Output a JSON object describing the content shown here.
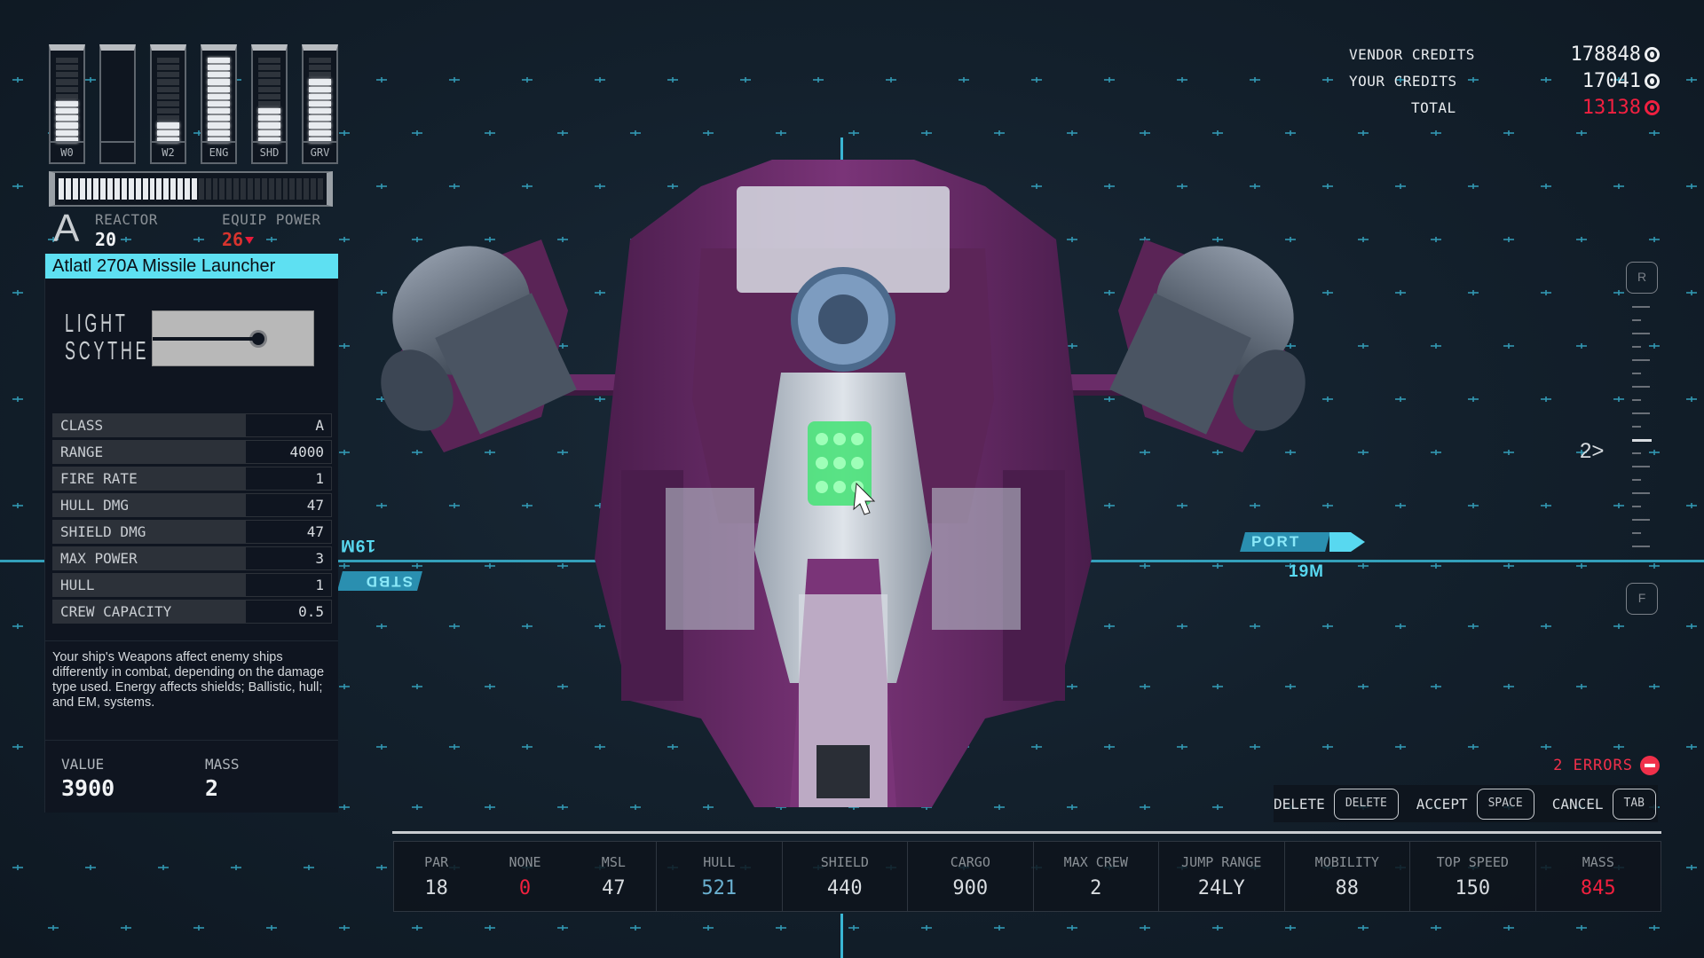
{
  "power_allocation": {
    "segments_per_bar": 12,
    "bars": [
      {
        "label": "W0",
        "filled": 6
      },
      {
        "label": "",
        "filled": 0
      },
      {
        "label": "W2",
        "filled": 3
      },
      {
        "label": "ENG",
        "filled": 12
      },
      {
        "label": "SHD",
        "filled": 5
      },
      {
        "label": "GRV",
        "filled": 9
      }
    ],
    "reactor_bar": {
      "segments": 38,
      "filled": 20
    }
  },
  "reactor": {
    "class_glyph": "A",
    "reactor_label": "REACTOR",
    "reactor_value": "20",
    "equip_power_label": "EQUIP POWER",
    "equip_power_value": "26"
  },
  "item": {
    "title": "Atlatl 270A Missile Launcher",
    "manufacturer_line1": "LIGHT",
    "manufacturer_line2": "SCYTHE",
    "stats": [
      {
        "key": "CLASS",
        "value": "A"
      },
      {
        "key": "RANGE",
        "value": "4000"
      },
      {
        "key": "FIRE RATE",
        "value": "1"
      },
      {
        "key": "HULL DMG",
        "value": "47"
      },
      {
        "key": "SHIELD DMG",
        "value": "47"
      },
      {
        "key": "MAX POWER",
        "value": "3"
      },
      {
        "key": "HULL",
        "value": "1"
      },
      {
        "key": "CREW CAPACITY",
        "value": "0.5"
      }
    ],
    "description": "Your ship's Weapons affect enemy ships differently in combat, depending on the damage type used. Energy affects shields; Ballistic, hull; and EM, systems.",
    "value_label": "VALUE",
    "value": "3900",
    "mass_label": "MASS",
    "mass": "2"
  },
  "credits": {
    "vendor_label": "VENDOR CREDITS",
    "vendor_value": "178848",
    "your_label": "YOUR CREDITS",
    "your_value": "17041",
    "total_label": "TOTAL",
    "total_value": "13138",
    "icon": "credits-icon"
  },
  "viewport": {
    "port_label": "PORT",
    "port_distance": "19M",
    "stbd_label": "STBD",
    "stbd_distance": "19M",
    "camera_top_button": "R",
    "camera_bottom_button": "F",
    "camera_level": "2"
  },
  "status": {
    "errors_text": "2 ERRORS"
  },
  "actions": [
    {
      "label": "DELETE",
      "key": "DELETE"
    },
    {
      "label": "ACCEPT",
      "key": "SPACE"
    },
    {
      "label": "CANCEL",
      "key": "TAB"
    }
  ],
  "ship_stats": {
    "weapons": [
      {
        "label": "PAR",
        "value": "18"
      },
      {
        "label": "NONE",
        "value": "0"
      },
      {
        "label": "MSL",
        "value": "47"
      }
    ],
    "hull": {
      "label": "HULL",
      "value": "521"
    },
    "shield": {
      "label": "SHIELD",
      "value": "440"
    },
    "cargo": {
      "label": "CARGO",
      "value": "900"
    },
    "max_crew": {
      "label": "MAX CREW",
      "value": "2"
    },
    "jump_range": {
      "label": "JUMP RANGE",
      "value": "24LY"
    },
    "mobility": {
      "label": "MOBILITY",
      "value": "88"
    },
    "top_speed": {
      "label": "TOP SPEED",
      "value": "150"
    },
    "mass": {
      "label": "MASS",
      "value": "845"
    }
  },
  "colors": {
    "accent_cyan": "#5ee0f2",
    "error_red": "#f0304a",
    "ship_purple": "#6a2a68"
  }
}
